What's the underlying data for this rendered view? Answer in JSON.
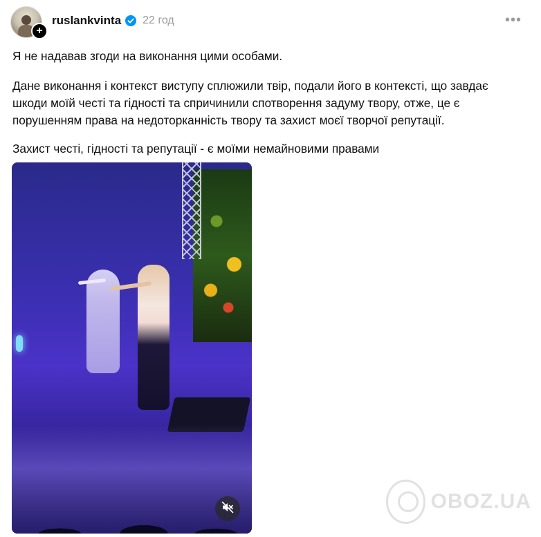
{
  "post": {
    "username": "ruslankvinta",
    "timestamp": "22 год",
    "more_icon": "more-horizontal-icon",
    "paragraphs": [
      "Я не надавав згоди на виконання цими особами.",
      "Дане виконання і контекст виступу сплюжили твір, подали його в контексті, що завдає шкоди моїй честі та гідності та спричинили спотворення задуму твору, отже, це є порушенням права на недоторканність твору та захист моєї творчої репутації.",
      "Захист честі, гідності та репутації - є моїми немайновими правами"
    ],
    "follow_icon": "plus-icon",
    "verified_icon": "verified-badge-icon",
    "mute_icon": "speaker-muted-icon"
  },
  "watermark": {
    "text": "OBOZ.UA"
  },
  "colors": {
    "verified": "#0095f6",
    "text": "#101010",
    "secondary": "#9a9a9a"
  }
}
